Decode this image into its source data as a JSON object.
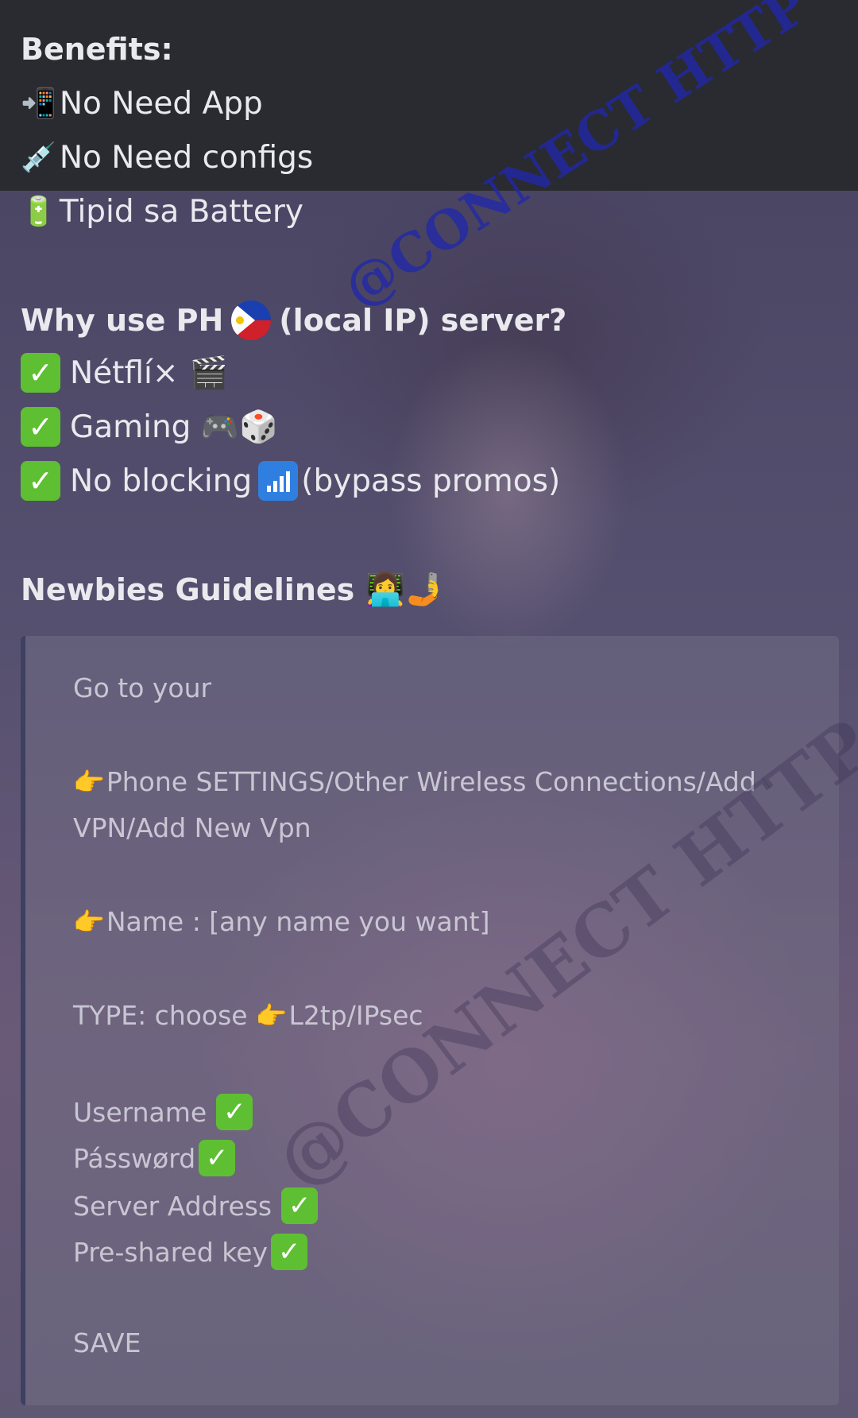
{
  "benefits": {
    "title": "Benefits:",
    "items": [
      {
        "icon": "phone-arrow-icon",
        "glyph": "📲",
        "text": "No Need App"
      },
      {
        "icon": "syringe-icon",
        "glyph": "💉",
        "text": "No Need configs"
      },
      {
        "icon": "battery-icon",
        "glyph": "🔋",
        "text": "Tipid sa Battery"
      }
    ]
  },
  "why": {
    "title_before": "Why use PH",
    "title_after": "(local IP) server?",
    "items": [
      {
        "text": "Nétflí×",
        "emoji": "🎬"
      },
      {
        "text": "Gaming",
        "emoji": "🎮🎲"
      },
      {
        "text": "No blocking",
        "after": "(bypass promos)"
      }
    ]
  },
  "guidelines": {
    "title": "Newbies Guidelines",
    "emoji": "👩‍💻🤳",
    "lines": {
      "go_to": "Go to your",
      "path1": "Phone SETTINGS/Other Wireless Connections/Add",
      "path2": "VPN/Add New Vpn",
      "name": "Name : [any name you want]",
      "type_prefix": "TYPE: choose",
      "type_value": "L2tp/IPsec",
      "username": "Username",
      "password": "Pásswørd",
      "server": "Server Address",
      "psk": "Pre-shared key",
      "save": "SAVE"
    }
  },
  "watermark": "@CONNECT HTTP",
  "colors": {
    "background": "#2a2b31",
    "check_green": "#5fbf32",
    "watermark_blue": "#2028aa"
  }
}
